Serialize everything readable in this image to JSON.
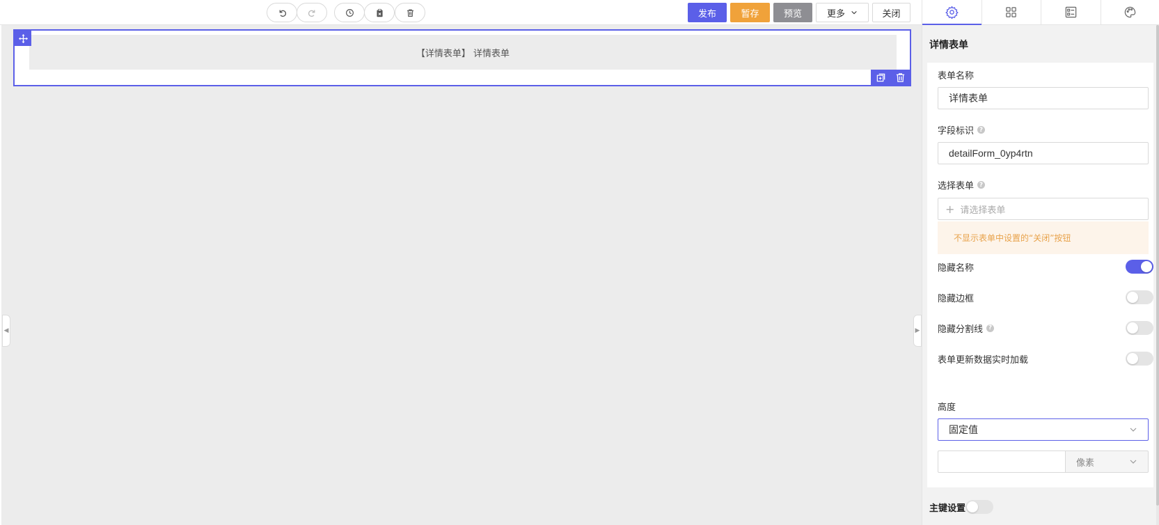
{
  "toolbar": {
    "history_buttons": [
      {
        "name": "undo-button",
        "icon": "undo-icon",
        "enabled": true
      },
      {
        "name": "redo-button",
        "icon": "redo-icon",
        "enabled": false
      },
      {
        "name": "history-button",
        "icon": "clock-icon",
        "enabled": true
      },
      {
        "name": "clear-button",
        "icon": "clipboard-clear-icon",
        "enabled": true
      },
      {
        "name": "delete-all-button",
        "icon": "trash-icon",
        "enabled": true
      }
    ],
    "publish_label": "发布",
    "draft_label": "暂存",
    "preview_label": "预览",
    "more_label": "更多",
    "close_label": "关闭"
  },
  "canvas": {
    "widget_label": "【详情表单】 详情表单"
  },
  "panel": {
    "tabs": [
      {
        "name": "tab-settings",
        "icon": "gear-icon",
        "active": true
      },
      {
        "name": "tab-components",
        "icon": "grid-icon",
        "active": false
      },
      {
        "name": "tab-form",
        "icon": "form-list-icon",
        "active": false
      },
      {
        "name": "tab-theme",
        "icon": "palette-icon",
        "active": false
      }
    ],
    "title": "详情表单",
    "form_name_label": "表单名称",
    "form_name_value": "详情表单",
    "field_id_label": "字段标识",
    "field_id_value": "detailForm_0yp4rtn",
    "select_form_label": "选择表单",
    "select_form_placeholder": "请选择表单",
    "notice_text": "不显示表单中设置的“关闭”按钮",
    "toggles": [
      {
        "label": "隐藏名称",
        "on": true,
        "has_help": false
      },
      {
        "label": "隐藏边框",
        "on": false,
        "has_help": false
      },
      {
        "label": "隐藏分割线",
        "on": false,
        "has_help": true
      },
      {
        "label": "表单更新数据实时加载",
        "on": false,
        "has_help": false
      }
    ],
    "height_label": "高度",
    "height_mode": "固定值",
    "height_value": "",
    "height_unit": "像素",
    "primary_key_label": "主键设置",
    "primary_key_on": false
  },
  "colors": {
    "accent": "#5b5fe8",
    "draft": "#f0a23a",
    "preview": "#8e8e93",
    "notice_text": "#e8a24a",
    "notice_bg": "#fdf4ea"
  }
}
